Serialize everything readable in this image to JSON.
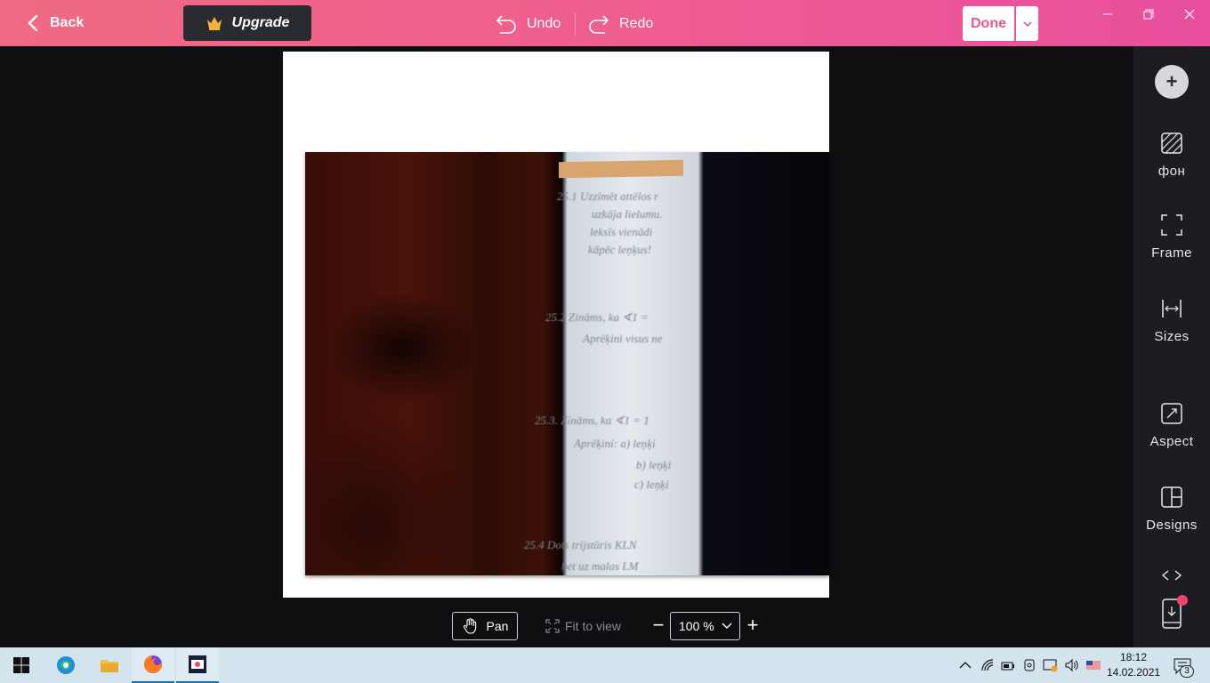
{
  "header": {
    "back_label": "Back",
    "upgrade_label": "Upgrade",
    "undo_label": "Undo",
    "redo_label": "Redo",
    "done_label": "Done"
  },
  "photo": {
    "text_lines": [
      "25.1  Uzzīmēt attēlos r",
      "uzkāja lielumu.",
      "leksīs vienādi",
      "kāpēc leņķus!",
      "25.2  Zināms, ka ∢1 =",
      "Aprēķini visus ne",
      "25.3.  Zināms, ka ∢1 = 1",
      "Aprēķini: a) leņķi",
      "b) leņķi",
      "c) leņķi",
      "25.4  Dots trijstūris KLN",
      "bet uz malas LM"
    ]
  },
  "toolbar": {
    "pan_label": "Pan",
    "fit_label": "Fit to view",
    "zoom_value": "100 %"
  },
  "sidebar": {
    "background_label": "фон",
    "frame_label": "Frame",
    "sizes_label": "Sizes",
    "aspect_label": "Aspect",
    "designs_label": "Designs"
  },
  "taskbar": {
    "time": "18:12",
    "date": "14.02.2021",
    "notification_count": "3"
  },
  "colors": {
    "accent": "#ef5f8e",
    "done_text": "#e85a86",
    "sidebar_bg": "#1c1c21",
    "canvas_bg": "#0f0f12"
  }
}
